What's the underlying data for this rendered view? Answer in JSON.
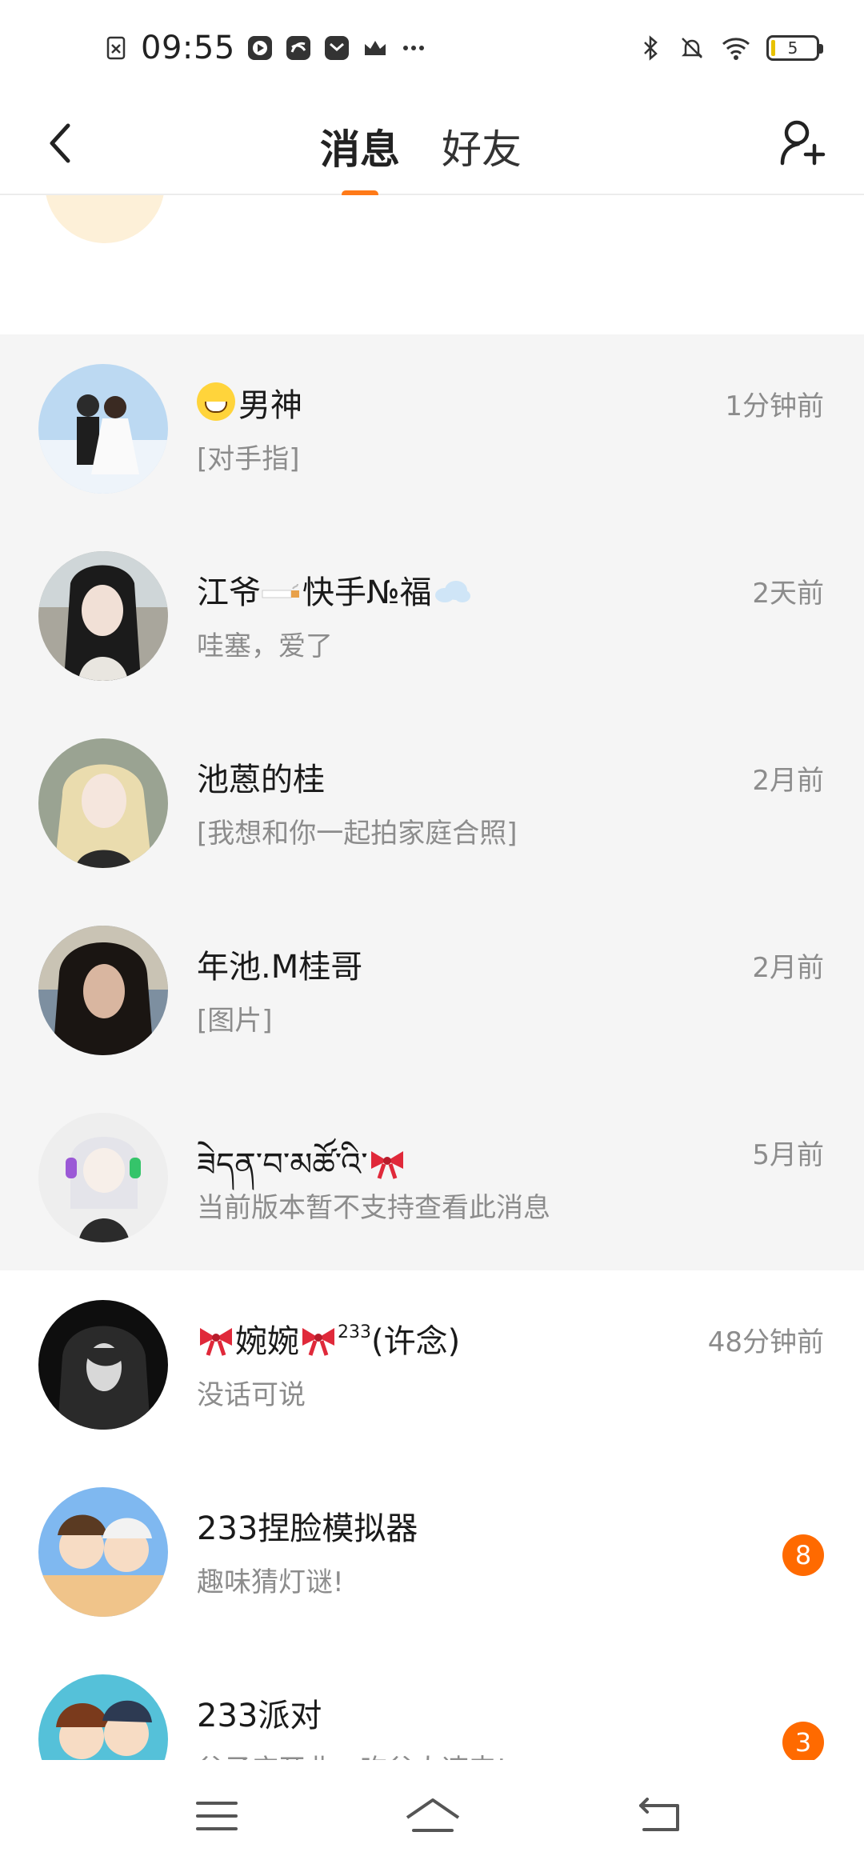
{
  "status_bar": {
    "time": "09:55",
    "battery_level": "5",
    "icons": [
      "sim-missing-icon",
      "video-app-icon",
      "link-app-icon",
      "mail-app-icon",
      "crown-icon",
      "more-dots-icon",
      "bluetooth-icon",
      "mute-bell-icon",
      "wifi-icon",
      "battery-icon"
    ]
  },
  "header": {
    "tabs": [
      {
        "label": "消息",
        "active": true
      },
      {
        "label": "好友",
        "active": false
      }
    ],
    "accent_color": "#ff7a18"
  },
  "conversations": [
    {
      "name": "男神",
      "name_prefix_icon": "grin-emoji-icon",
      "preview": "[对手指]",
      "time": "1分钟前",
      "pinned": true
    },
    {
      "name_part1": "江爷",
      "name_part2": "快手№福",
      "preview": "哇塞，爱了",
      "time": "2天前",
      "pinned": true
    },
    {
      "name": "池蒽的桂",
      "preview": "[我想和你一起拍家庭合照]",
      "time": "2月前",
      "pinned": true
    },
    {
      "name": "年池.M桂哥",
      "preview": "[图片]",
      "time": "2月前",
      "pinned": true
    },
    {
      "name": "ཟེདན་བ་མཚོ་འི་",
      "preview": "当前版本暂不支持查看此消息",
      "time": "5月前",
      "pinned": true
    },
    {
      "name_part1": "婉婉",
      "name_sup": "233",
      "name_part2": "(许念)",
      "preview": "没话可说",
      "time": "48分钟前",
      "pinned": false
    },
    {
      "name": "233捏脸模拟器",
      "preview": "趣味猜灯谜!",
      "badge": "8",
      "pinned": false
    },
    {
      "name": "233派对",
      "preview": "谷子店开业，吃谷人速来!",
      "badge": "3",
      "pinned": false
    }
  ]
}
